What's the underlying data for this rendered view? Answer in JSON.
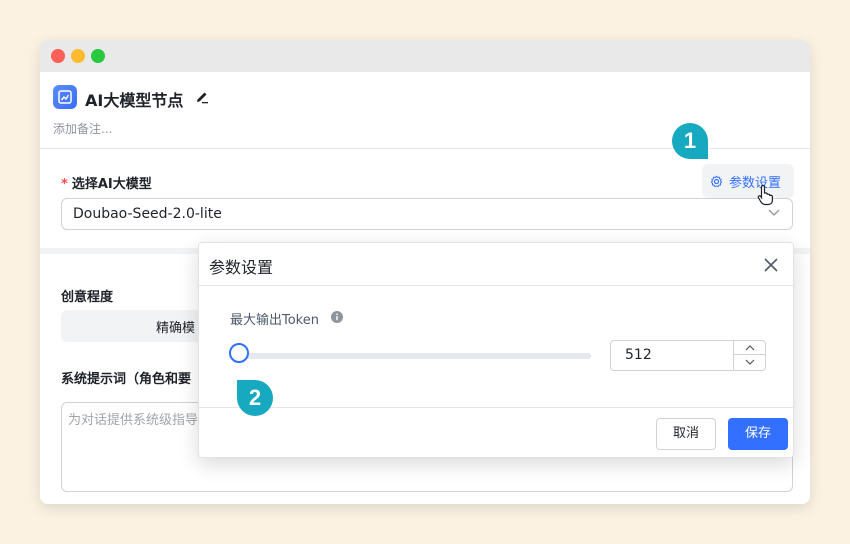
{
  "node": {
    "title": "AI大模型节点",
    "note_placeholder": "添加备注..."
  },
  "model_section": {
    "label": "选择AI大模型",
    "required_mark": "*",
    "param_button": "参数设置",
    "selected_model": "Doubao-Seed-2.0-lite"
  },
  "creativity": {
    "label": "创意程度",
    "option": "精确模"
  },
  "system_prompt": {
    "label": "系统提示词（角色和要",
    "placeholder": "为对话提供系统级指导"
  },
  "dialog": {
    "title": "参数设置",
    "token_label": "最大输出Token",
    "token_value": "512",
    "slider_fraction": 0.0,
    "cancel": "取消",
    "save": "保存"
  },
  "markers": {
    "one": "1",
    "two": "2"
  },
  "colors": {
    "accent": "#3370ff",
    "marker": "#16a9c0",
    "background": "#fbf2e2"
  }
}
